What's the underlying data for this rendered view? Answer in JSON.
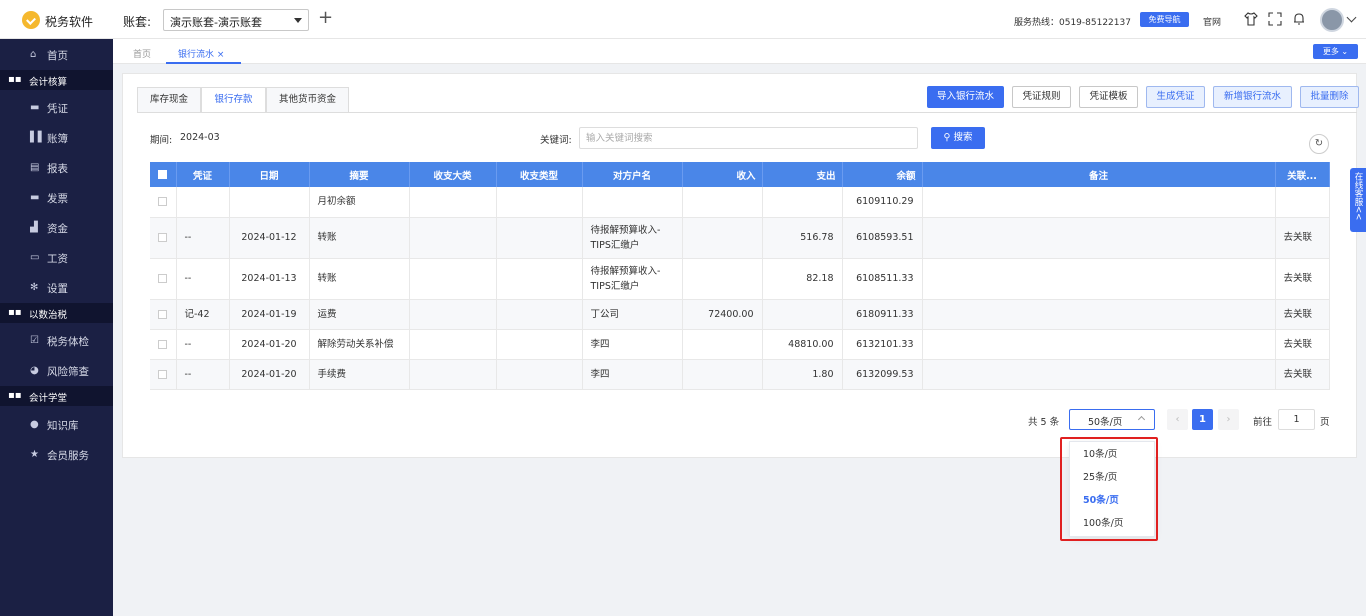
{
  "header": {
    "app_name": "税务软件",
    "account_label": "账套:",
    "account_value": "演示账套-演示账套",
    "hotline": "服务热线：0519-85122137",
    "guide_button": "免费导航",
    "website_link": "官网"
  },
  "sidebar": {
    "items": [
      {
        "label": "首页",
        "icon": "home-icon",
        "type": "item"
      },
      {
        "label": "会计核算",
        "icon": "grid-icon",
        "type": "group"
      },
      {
        "label": "凭证",
        "icon": "ticket-icon",
        "type": "item"
      },
      {
        "label": "账簿",
        "icon": "books-icon",
        "type": "item"
      },
      {
        "label": "报表",
        "icon": "report-icon",
        "type": "item"
      },
      {
        "label": "发票",
        "icon": "invoice-icon",
        "type": "item"
      },
      {
        "label": "资金",
        "icon": "fund-icon",
        "type": "item"
      },
      {
        "label": "工资",
        "icon": "salary-icon",
        "type": "item"
      },
      {
        "label": "设置",
        "icon": "gear-icon",
        "type": "item"
      },
      {
        "label": "以数治税",
        "icon": "grid-icon",
        "type": "group"
      },
      {
        "label": "税务体检",
        "icon": "checkup-icon",
        "type": "item"
      },
      {
        "label": "风险筛查",
        "icon": "risk-icon",
        "type": "item"
      },
      {
        "label": "会计学堂",
        "icon": "grid-icon",
        "type": "group"
      },
      {
        "label": "知识库",
        "icon": "pin-icon",
        "type": "item"
      },
      {
        "label": "会员服务",
        "icon": "star-icon",
        "type": "item"
      }
    ]
  },
  "tabs": {
    "home": "首页",
    "bank_flow": "银行流水",
    "more": "更多"
  },
  "subtabs": [
    "库存现金",
    "银行存款",
    "其他货币资金"
  ],
  "toolbar": {
    "import": "导入银行流水",
    "rules": "凭证规则",
    "template": "凭证模板",
    "generate": "生成凭证",
    "add": "新增银行流水",
    "batch_delete": "批量删除"
  },
  "filter": {
    "period_label": "期间:",
    "period_value": "2024-03",
    "keyword_label": "关键词:",
    "keyword_placeholder": "输入关键词搜索",
    "search_button": "搜索"
  },
  "table": {
    "columns": [
      "凭证",
      "日期",
      "摘要",
      "收支大类",
      "收支类型",
      "对方户名",
      "收入",
      "支出",
      "余额",
      "备注",
      "关联..."
    ],
    "rows": [
      {
        "voucher": "",
        "date": "",
        "summary": "月初余额",
        "category": "",
        "type": "",
        "counterparty": "",
        "income": "",
        "expense": "",
        "balance": "6109110.29",
        "note": "",
        "link": ""
      },
      {
        "voucher": "--",
        "date": "2024-01-12",
        "summary": "转账",
        "category": "",
        "type": "",
        "counterparty": "待报解预算收入-TIPS汇缴户",
        "income": "",
        "expense": "516.78",
        "balance": "6108593.51",
        "note": "",
        "link": "去关联"
      },
      {
        "voucher": "--",
        "date": "2024-01-13",
        "summary": "转账",
        "category": "",
        "type": "",
        "counterparty": "待报解预算收入-TIPS汇缴户",
        "income": "",
        "expense": "82.18",
        "balance": "6108511.33",
        "note": "",
        "link": "去关联"
      },
      {
        "voucher": "记-42",
        "date": "2024-01-19",
        "summary": "运费",
        "category": "",
        "type": "",
        "counterparty": "丁公司",
        "income": "72400.00",
        "expense": "",
        "balance": "6180911.33",
        "note": "",
        "link": "去关联"
      },
      {
        "voucher": "--",
        "date": "2024-01-20",
        "summary": "解除劳动关系补偿",
        "category": "",
        "type": "",
        "counterparty": "李四",
        "income": "",
        "expense": "48810.00",
        "balance": "6132101.33",
        "note": "",
        "link": "去关联"
      },
      {
        "voucher": "--",
        "date": "2024-01-20",
        "summary": "手续费",
        "category": "",
        "type": "",
        "counterparty": "李四",
        "income": "",
        "expense": "1.80",
        "balance": "6132099.53",
        "note": "",
        "link": "去关联"
      }
    ]
  },
  "pagination": {
    "total": "共 5 条",
    "page_size": "50条/页",
    "prev": "‹",
    "current_page": "1",
    "next": "›",
    "goto_label": "前往",
    "goto_value": "1",
    "page_unit": "页",
    "options": [
      "10条/页",
      "25条/页",
      "50条/页",
      "100条/页"
    ]
  },
  "service_tab": "在线客服<<",
  "colors": {
    "primary": "#3a6df0",
    "sidebar": "#1b2044",
    "header_row": "#4a86e8",
    "highlight": "#e02020"
  }
}
